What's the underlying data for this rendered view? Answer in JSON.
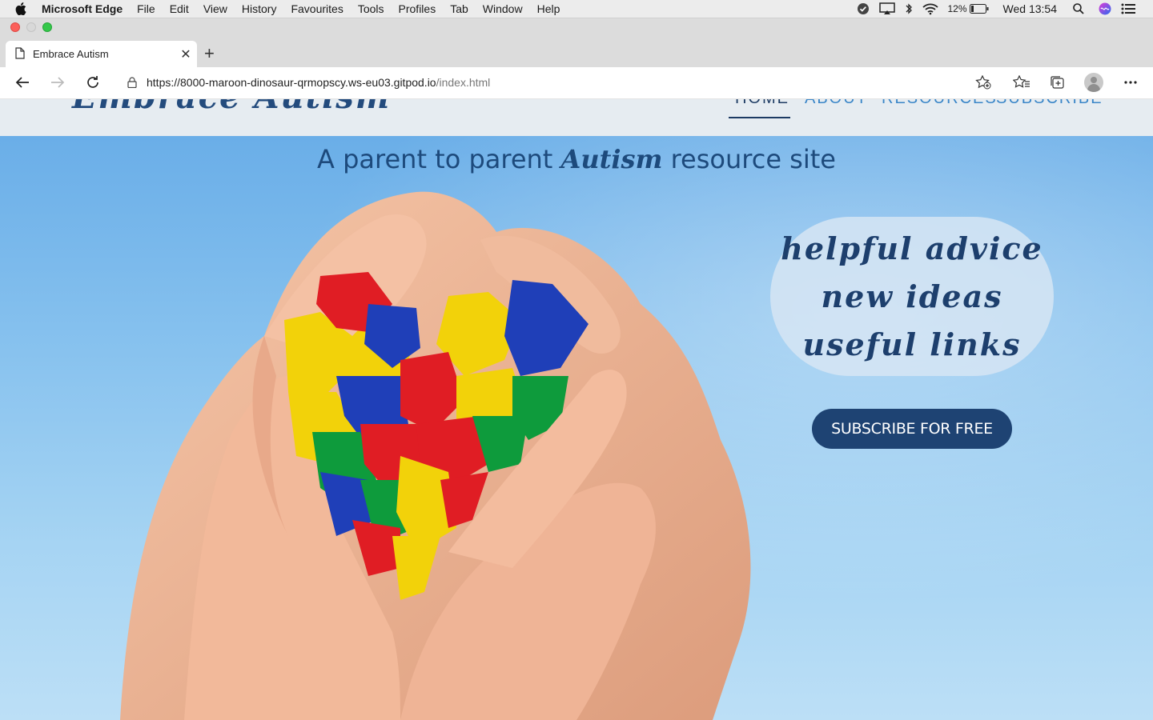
{
  "menubar": {
    "app_name": "Microsoft Edge",
    "items": [
      "File",
      "Edit",
      "View",
      "History",
      "Favourites",
      "Tools",
      "Profiles",
      "Tab",
      "Window",
      "Help"
    ],
    "battery_percent": "12%",
    "clock": "Wed 13:54"
  },
  "browser": {
    "tab_title": "Embrace Autism",
    "url_host": "https://8000-maroon-dinosaur-qrmopscy.ws-eu03.gitpod.io",
    "url_path": "/index.html"
  },
  "site": {
    "logo": "Embrace Autism",
    "nav": [
      "HOME",
      "ABOUT",
      "RESOURCES",
      "SUBSCRIBE"
    ],
    "active_nav": "HOME",
    "hero_title_pre": "A parent to parent ",
    "hero_title_emph": "Autism",
    "hero_title_post": " resource site",
    "bubble_lines": [
      "helpful advice",
      "new ideas",
      "useful links"
    ],
    "subscribe_label": "SUBSCRIBE FOR FREE"
  },
  "colors": {
    "brand_dark": "#1e4373",
    "nav_link": "#3a86c8",
    "header_bg": "#e6ecf1"
  }
}
